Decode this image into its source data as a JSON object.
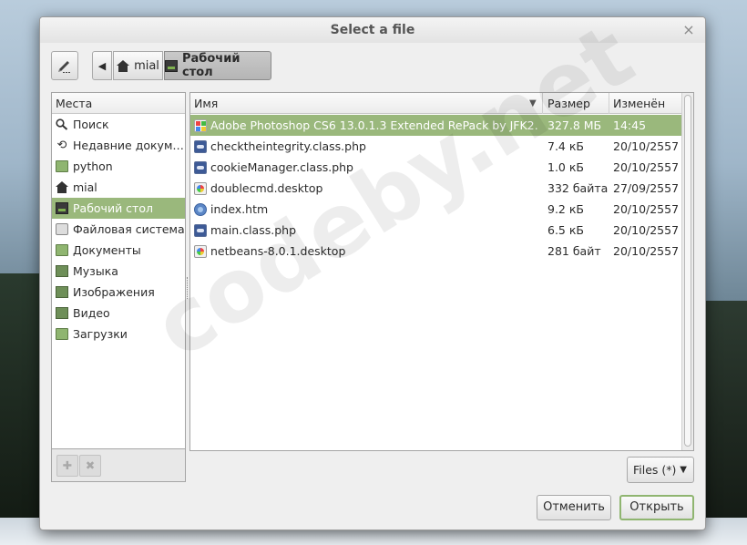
{
  "dialog": {
    "title": "Select a file",
    "close_glyph": "×"
  },
  "pathbar": {
    "back_glyph": "◀",
    "home_label": "mial",
    "current_label": "Рабочий стол"
  },
  "places": {
    "header": "Места",
    "items": [
      {
        "label": "Поиск",
        "icon": "search-icon"
      },
      {
        "label": "Недавние докум…",
        "icon": "recent-icon"
      },
      {
        "label": "python",
        "icon": "folder-icon"
      },
      {
        "label": "mial",
        "icon": "home-icon"
      },
      {
        "label": "Рабочий стол",
        "icon": "desktop-icon",
        "selected": true
      },
      {
        "label": "Файловая система",
        "icon": "drive-icon"
      },
      {
        "label": "Документы",
        "icon": "folder-icon"
      },
      {
        "label": "Музыка",
        "icon": "music-folder-icon"
      },
      {
        "label": "Изображения",
        "icon": "pictures-folder-icon"
      },
      {
        "label": "Видео",
        "icon": "video-folder-icon"
      },
      {
        "label": "Загрузки",
        "icon": "downloads-folder-icon"
      }
    ],
    "add_glyph": "✚",
    "remove_glyph": "✖"
  },
  "files": {
    "columns": {
      "name": "Имя",
      "size": "Размер",
      "modified": "Изменён"
    },
    "sort_glyph": "▼",
    "rows": [
      {
        "name": "Adobe Photoshop CS6 13.0.1.3 Extended RePack by JFK2…",
        "size": "327.8 МБ",
        "modified": "14:45",
        "icon": "executable-file-icon",
        "selected": true
      },
      {
        "name": "checktheintegrity.class.php",
        "size": "7.4 кБ",
        "modified": "20/10/2557",
        "icon": "php-file-icon"
      },
      {
        "name": "cookieManager.class.php",
        "size": "1.0 кБ",
        "modified": "20/10/2557",
        "icon": "php-file-icon"
      },
      {
        "name": "doublecmd.desktop",
        "size": "332 байта",
        "modified": "27/09/2557",
        "icon": "desktop-file-icon"
      },
      {
        "name": "index.htm",
        "size": "9.2 кБ",
        "modified": "20/10/2557",
        "icon": "html-file-icon"
      },
      {
        "name": "main.class.php",
        "size": "6.5 кБ",
        "modified": "20/10/2557",
        "icon": "php-file-icon"
      },
      {
        "name": "netbeans-8.0.1.desktop",
        "size": "281 байт",
        "modified": "20/10/2557",
        "icon": "desktop-file-icon"
      }
    ]
  },
  "filter": {
    "label": "Files (*)",
    "caret": "▼"
  },
  "buttons": {
    "cancel": "Отменить",
    "open": "Открыть"
  },
  "watermark": "codeby.net",
  "colors": {
    "selection": "#9ab87c",
    "accent": "#8fb570"
  }
}
